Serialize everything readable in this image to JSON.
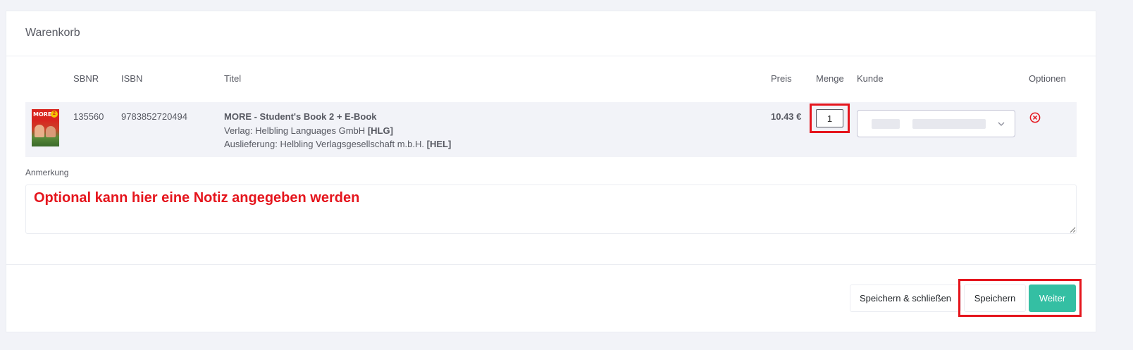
{
  "card": {
    "title": "Warenkorb"
  },
  "table": {
    "headers": {
      "sbnr": "SBNR",
      "isbn": "ISBN",
      "titel": "Titel",
      "preis": "Preis",
      "menge": "Menge",
      "kunde": "Kunde",
      "optionen": "Optionen"
    },
    "rows": [
      {
        "thumbnail_brand": "MORE!",
        "thumbnail_badge": "2",
        "sbnr": "135560",
        "isbn": "9783852720494",
        "title": "MORE - Student's Book 2 + E-Book",
        "verlag_label": "Verlag: Helbling Languages GmbH",
        "verlag_code": "[HLG]",
        "auslieferung_label": "Auslieferung: Helbling Verlagsgesellschaft m.b.H.",
        "auslieferung_code": "[HEL]",
        "price": "10.43 €",
        "quantity": "1",
        "kunde_value": ""
      }
    ]
  },
  "note": {
    "label": "Anmerkung",
    "text": "Optional kann hier eine Notiz angegeben werden"
  },
  "footer": {
    "save_close_label": "Speichern & schließen",
    "save_label": "Speichern",
    "next_label": "Weiter"
  },
  "colors": {
    "accent_green": "#34bfa3",
    "highlight_red": "#e5151d",
    "row_background": "#f2f3f8"
  },
  "icons": {
    "remove": "circle-x-icon",
    "select_arrow": "chevron-down-icon"
  }
}
